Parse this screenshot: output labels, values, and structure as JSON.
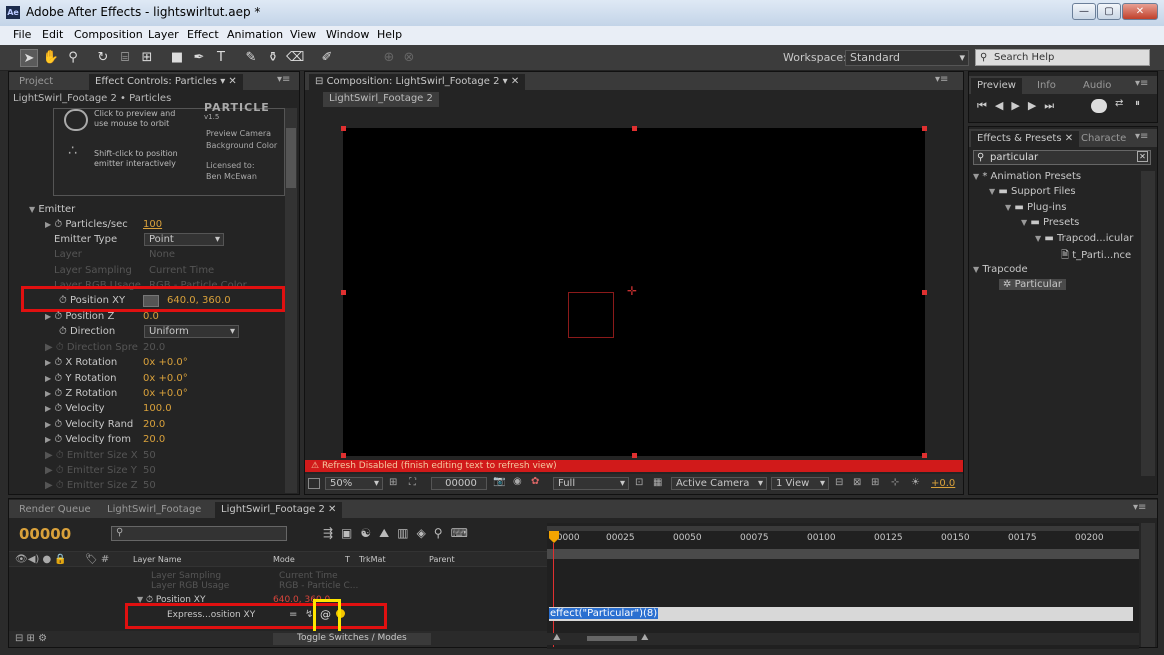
{
  "window": {
    "app_icon": "Ae",
    "title": "Adobe After Effects - lightswirltut.aep *"
  },
  "menu": [
    "File",
    "Edit",
    "Composition",
    "Layer",
    "Effect",
    "Animation",
    "View",
    "Window",
    "Help"
  ],
  "workspace": {
    "label": "Workspace:",
    "value": "Standard"
  },
  "search_help": {
    "placeholder": "Search Help"
  },
  "left_panel": {
    "tabs": [
      "Project",
      "Effect Controls: Particles"
    ],
    "breadcrumb": "LightSwirl_Footage 2 • Particles",
    "logo_text": "PARTICLE",
    "version": "v1.5",
    "hint1": "Click to preview and use mouse to orbit",
    "hint2": "Shift-click to position emitter interactively",
    "info1": "Preview Camera",
    "info2": "Background Color",
    "info3": "Licensed to:",
    "info4": "Ben McEwan",
    "emitter": "Emitter",
    "props": [
      {
        "name": "Particles/sec",
        "value": "100"
      },
      {
        "name": "Emitter Type",
        "value": "Point"
      },
      {
        "name": "Layer",
        "value": "None"
      },
      {
        "name": "Layer Sampling",
        "value": "Current Time"
      },
      {
        "name": "Layer RGB Usage",
        "value": "RGB - Particle Color"
      },
      {
        "name": "Position XY",
        "value_x": "640.0",
        "value_y": "360.0"
      },
      {
        "name": "Position Z",
        "value": "0.0"
      },
      {
        "name": "Direction",
        "value": "Uniform"
      },
      {
        "name": "Direction Spre",
        "value": "20.0"
      },
      {
        "name": "X Rotation",
        "value_a": "0x",
        "value_b": "+0.0°"
      },
      {
        "name": "Y Rotation",
        "value_a": "0x",
        "value_b": "+0.0°"
      },
      {
        "name": "Z Rotation",
        "value_a": "0x",
        "value_b": "+0.0°"
      },
      {
        "name": "Velocity",
        "value": "100.0"
      },
      {
        "name": "Velocity Rand",
        "value": "20.0"
      },
      {
        "name": "Velocity from",
        "value": "20.0"
      },
      {
        "name": "Emitter Size X",
        "value": "50"
      },
      {
        "name": "Emitter Size Y",
        "value": "50"
      },
      {
        "name": "Emitter Size Z",
        "value": "50"
      }
    ]
  },
  "comp_panel": {
    "tab": "Composition: LightSwirl_Footage 2",
    "subtab": "LightSwirl_Footage 2",
    "warning": "Refresh Disabled (finish editing text to refresh view)",
    "zoom": "50%",
    "timecode": "00000",
    "resolution": "Full",
    "camera": "Active Camera",
    "views": "1 View",
    "exposure": "+0.0"
  },
  "right_panel": {
    "tabs": [
      "Preview",
      "Info",
      "Audio"
    ],
    "effects_tabs": [
      "Effects & Presets",
      "Characte"
    ],
    "search_value": "particular",
    "tree": [
      {
        "label": "* Animation Presets",
        "level": 0
      },
      {
        "label": "Support Files",
        "level": 1
      },
      {
        "label": "Plug-ins",
        "level": 2
      },
      {
        "label": "Presets",
        "level": 3
      },
      {
        "label": "Trapcod...icular",
        "level": 4
      },
      {
        "label": "t_Parti...nce",
        "level": 5
      },
      {
        "label": "Trapcode",
        "level": 0
      },
      {
        "label": "Particular",
        "level": 1
      }
    ]
  },
  "timeline": {
    "tabs": [
      "Render Queue",
      "LightSwirl_Footage",
      "LightSwirl_Footage 2"
    ],
    "timecode": "00000",
    "columns": {
      "layer_name": "Layer Name",
      "mode": "Mode",
      "t": "T",
      "trkmat": "TrkMat",
      "parent": "Parent"
    },
    "ruler": [
      "00000",
      "00025",
      "00050",
      "00075",
      "00100",
      "00125",
      "00150",
      "00175",
      "00200"
    ],
    "rows": {
      "faded1": "Layer Sampling",
      "faded2": "Layer RGB Usage",
      "faded2_val": "RGB - Particle C...",
      "faded1_val": "Current Time",
      "position": "Position XY",
      "position_val": "640.0, 360.0",
      "expression": "Express...osition XY"
    },
    "expression_text": "effect(\"Particular\")(8)",
    "toggle": "Toggle Switches / Modes"
  }
}
